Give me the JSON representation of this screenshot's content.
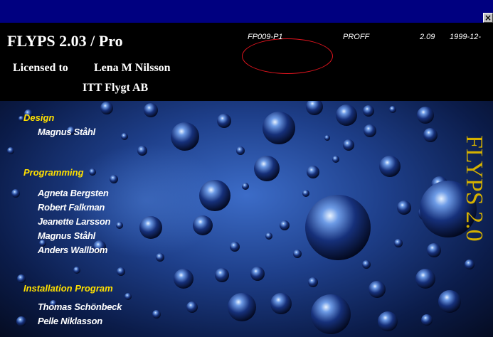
{
  "window": {
    "close_label": "×"
  },
  "header": {
    "app_title": "FLYPS 2.03 / Pro",
    "serial": "FP009-P1",
    "edition": "PROFF",
    "version": "2.09",
    "date": "1999-12-",
    "licensed_label": "Licensed to",
    "licensee_name": "Lena M Nilsson",
    "licensee_company": "ITT Flygt AB"
  },
  "credits": [
    {
      "heading": "Design",
      "names": [
        "Magnus Ståhl"
      ]
    },
    {
      "heading": "Programming",
      "names": [
        "Agneta Bergsten",
        "Robert Falkman",
        "Jeanette Larsson",
        "Magnus Ståhl",
        "Anders Wallbom"
      ]
    },
    {
      "heading": "Installation Program",
      "names": [
        "Thomas Schönbeck",
        "Pelle Niklasson"
      ]
    }
  ],
  "logo_text": "FLYPS 2.0",
  "colors": {
    "title_bar": "#000080",
    "heading_yellow": "#ffe000",
    "logo_gold": "#d4b000",
    "highlight_ring": "#e0141e"
  }
}
